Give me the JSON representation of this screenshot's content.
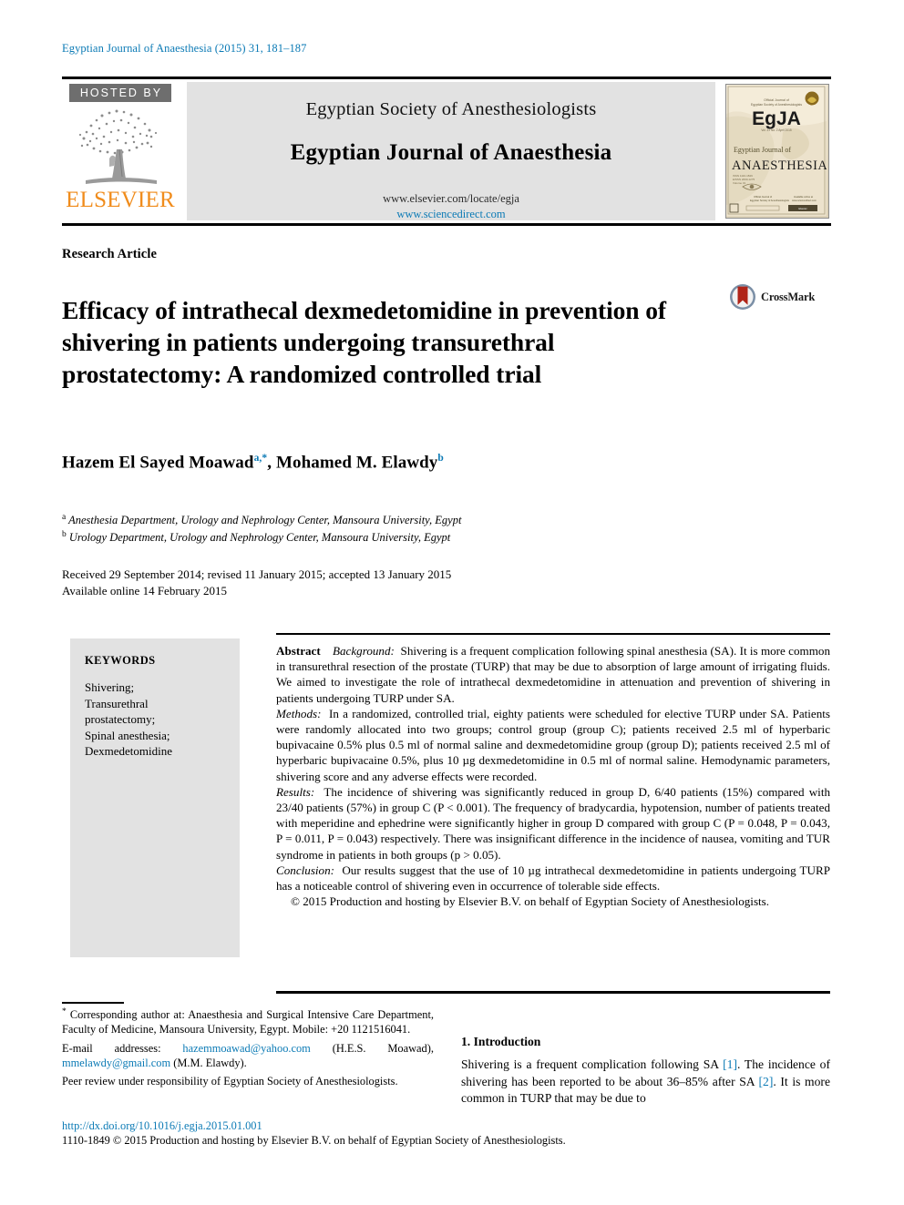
{
  "running_head": "Egyptian Journal of Anaesthesia (2015) 31, 181–187",
  "masthead": {
    "hosted_by": "HOSTED BY",
    "publisher": "ELSEVIER",
    "society": "Egyptian Society of Anesthesiologists",
    "journal": "Egyptian Journal of Anaesthesia",
    "url_locate": "www.elsevier.com/locate/egja",
    "url_sciencedirect": "www.sciencedirect.com",
    "cover": {
      "official_line1": "Official Journal of",
      "official_line2": "Egyptian Society of Anesthesiologists",
      "acronym": "EgJA",
      "issue_line": "Vol. 31  No. 2  April 2015",
      "title_small": "Egyptian Journal of",
      "title_large": "ANAESTHESIA",
      "sub_lines": "ISSN 1110-1849\nEISSN 2090-1275\nVolume 31",
      "bottom_left": "Official Journal of\nEgyptian Society of Anesthesiologists",
      "bottom_right": "Available online at\nwww.sciencedirect.com"
    }
  },
  "article": {
    "type": "Research Article",
    "title": "Efficacy of intrathecal dexmedetomidine in prevention of shivering in patients undergoing transurethral prostatectomy: A randomized controlled trial",
    "crossmark_label": "CrossMark",
    "authors_plain": "Hazem El Sayed Moawad a,*, Mohamed M. Elawdy b",
    "authors": [
      {
        "name": "Hazem El Sayed Moawad",
        "marks": "a,*"
      },
      {
        "name": "Mohamed M. Elawdy",
        "marks": "b"
      }
    ],
    "affiliations": [
      {
        "mark": "a",
        "text": "Anesthesia Department, Urology and Nephrology Center, Mansoura University, Egypt"
      },
      {
        "mark": "b",
        "text": "Urology Department, Urology and Nephrology Center, Mansoura University, Egypt"
      }
    ],
    "history_line1": "Received 29 September 2014; revised 11 January 2015; accepted 13 January 2015",
    "history_line2": "Available online 14 February 2015"
  },
  "keywords": {
    "heading": "KEYWORDS",
    "items": "Shivering;\nTransurethral\nprostatectomy;\nSpinal anesthesia;\nDexmedetomidine",
    "list": [
      "Shivering;",
      "Transurethral",
      "prostatectomy;",
      "Spinal anesthesia;",
      "Dexmedetomidine"
    ]
  },
  "abstract": {
    "label": "Abstract",
    "background_head": "Background:",
    "background_text": "Shivering is a frequent complication following spinal anesthesia (SA). It is more common in transurethral resection of the prostate (TURP) that may be due to absorption of large amount of irrigating fluids. We aimed to investigate the role of intrathecal dexmedetomidine in attenuation and prevention of shivering in patients undergoing TURP under SA.",
    "methods_head": "Methods:",
    "methods_text": "In a randomized, controlled trial, eighty patients were scheduled for elective TURP under SA. Patients were randomly allocated into two groups; control group (group C); patients received 2.5 ml of hyperbaric bupivacaine 0.5% plus 0.5 ml of normal saline and dexmedetomidine group (group D); patients received 2.5 ml of hyperbaric bupivacaine 0.5%, plus 10 µg dexmedetomidine in 0.5 ml of normal saline. Hemodynamic parameters, shivering score and any adverse effects were recorded.",
    "results_head": "Results:",
    "results_text": "The incidence of shivering was significantly reduced in group D, 6/40 patients (15%) compared with 23/40 patients (57%) in group C (P < 0.001). The frequency of bradycardia, hypotension, number of patients treated with meperidine and ephedrine were significantly higher in group D compared with group C (P = 0.048, P = 0.043, P = 0.011, P = 0.043) respectively. There was insignificant difference in the incidence of nausea, vomiting and TUR syndrome in patients in both groups (p > 0.05).",
    "conclusion_head": "Conclusion:",
    "conclusion_text": "Our results suggest that the use of 10 µg intrathecal dexmedetomidine in patients undergoing TURP has a noticeable control of shivering even in occurrence of tolerable side effects.",
    "copyright": "© 2015 Production and hosting by Elsevier B.V. on behalf of Egyptian Society of Anesthesiologists."
  },
  "footnotes": {
    "corresponding": "Corresponding author at: Anaesthesia and Surgical Intensive Care Department, Faculty of Medicine, Mansoura University, Egypt. Mobile: +20 1121516041.",
    "email_label": "E-mail addresses:",
    "email1": "hazemmoawad@yahoo.com",
    "email1_owner": "(H.E.S. Moawad),",
    "email2": "mmelawdy@gmail.com",
    "email2_owner": "(M.M. Elawdy).",
    "peer_review": "Peer review under responsibility of Egyptian Society of Anesthesiologists.",
    "doi": "http://dx.doi.org/10.1016/j.egja.2015.01.001",
    "issn_line": "1110-1849 © 2015 Production and hosting by Elsevier B.V. on behalf of Egyptian Society of Anesthesiologists."
  },
  "introduction": {
    "heading": "1. Introduction",
    "text_part1": "Shivering is a frequent complication following SA ",
    "ref1": "[1]",
    "text_part2": ". The incidence of shivering has been reported to be about 36–85% after SA ",
    "ref2": "[2]",
    "text_part3": ". It is more common in TURP that may be due to"
  },
  "colors": {
    "link_blue": "#0b7ab5",
    "elsevier_orange": "#F08C1C",
    "panel_grey": "#e2e2e2",
    "hosted_grey": "#6e6e6e",
    "crossmark_red": "#b02418"
  }
}
